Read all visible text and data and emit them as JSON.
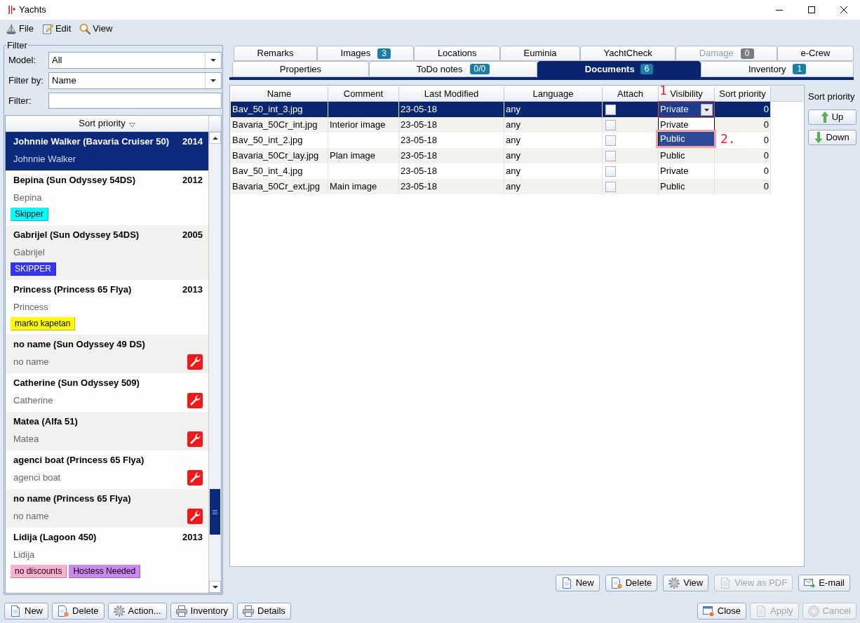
{
  "window": {
    "title": "Yachts"
  },
  "menu": [
    {
      "label": "File",
      "kind": "file"
    },
    {
      "label": "Edit",
      "kind": "edit"
    },
    {
      "label": "View",
      "kind": "view"
    }
  ],
  "filter": {
    "legend": "Filter",
    "fields": [
      {
        "label": "Model:",
        "kind": "combo",
        "value": "All"
      },
      {
        "label": "Filter by:",
        "kind": "combo",
        "value": "Name"
      },
      {
        "label": "Filter:",
        "kind": "text"
      }
    ]
  },
  "yacht_list": {
    "header": "Sort priority",
    "items": [
      {
        "title": "Johnnie Walker (Bavaria Cruiser 50)",
        "year": "2014",
        "subtitle": "Johnnie Walker",
        "selected": true,
        "service": false
      },
      {
        "title": "Bepina (Sun Odyssey 54DS)",
        "year": "2012",
        "subtitle": "Bepina",
        "selected": false,
        "service": false,
        "tags": [
          {
            "label": "Skipper",
            "color": "#00ffff"
          }
        ]
      },
      {
        "title": "Gabrijel (Sun Odyssey 54DS)",
        "year": "2005",
        "subtitle": "Gabrijel",
        "selected": false,
        "service": false,
        "tags": [
          {
            "label": "SKIPPER",
            "color": "#3333ff"
          }
        ]
      },
      {
        "title": "Princess (Princess 65 Flya)",
        "year": "2013",
        "subtitle": "Princess",
        "selected": false,
        "service": false,
        "tags": [
          {
            "label": "marko kapetan",
            "color": "#ffff00"
          }
        ]
      },
      {
        "title": "no name (Sun Odyssey 49 DS)",
        "subtitle": "no name",
        "selected": false,
        "service": true
      },
      {
        "title": "Catherine (Sun Odyssey 509)",
        "subtitle": "Catherine",
        "selected": false,
        "service": true
      },
      {
        "title": "Matea (Alfa 51)",
        "subtitle": "Matea",
        "selected": false,
        "service": true
      },
      {
        "title": "agenci boat (Princess 65 Flya)",
        "subtitle": "agenci boat",
        "selected": false,
        "service": true
      },
      {
        "title": "no name (Princess 65 Flya)",
        "subtitle": "no name",
        "selected": false,
        "service": true
      },
      {
        "title": "Lidija (Lagoon 450)",
        "year": "2013",
        "subtitle": "Lidija",
        "selected": false,
        "service": false,
        "tags": [
          {
            "label": "no discounts",
            "color": "#ffb0d0"
          },
          {
            "label": "Hostess Needed",
            "color": "#cc88f0"
          }
        ]
      }
    ]
  },
  "tab_strip": {
    "rows": [
      {
        "tabs": [
          {
            "label": "Remarks",
            "selected": false,
            "disabled": false
          },
          {
            "label": "Images",
            "badge": "3",
            "selected": false,
            "disabled": false
          },
          {
            "label": "Locations",
            "selected": false,
            "disabled": false
          },
          {
            "label": "Euminia",
            "selected": false,
            "disabled": false
          },
          {
            "label": "YachtCheck",
            "selected": false,
            "disabled": false
          },
          {
            "label": "Damage",
            "badge": "0",
            "selected": false,
            "disabled": true
          },
          {
            "label": "e-Crew",
            "selected": false,
            "disabled": false
          }
        ]
      },
      {
        "tabs": [
          {
            "label": "Properties",
            "selected": false,
            "disabled": false
          },
          {
            "label": "ToDo notes",
            "badge": "0/0",
            "selected": false,
            "disabled": false
          },
          {
            "label": "Documents",
            "badge": "6",
            "selected": true,
            "disabled": false
          },
          {
            "label": "Inventory",
            "badge": "1",
            "selected": false,
            "disabled": false
          }
        ]
      }
    ]
  },
  "documents_table": {
    "columns": [
      "Name",
      "Comment",
      "Last Modified",
      "Language",
      "Attach",
      "Visibility",
      "Sort priority"
    ],
    "rows": [
      {
        "name": "Bav_50_int_3.jpg",
        "last_modified": "23-05-18",
        "language": "any",
        "attach": false,
        "visibility": "Private",
        "sort_priority": "0",
        "selected": true
      },
      {
        "name": "Bavaria_50Cr_int.jpg",
        "comment": "Interior image",
        "last_modified": "23-05-18",
        "language": "any",
        "attach": false,
        "sort_priority": "0",
        "selected": false
      },
      {
        "name": "Bav_50_int_2.jpg",
        "last_modified": "23-05-18",
        "language": "any",
        "attach": false,
        "sort_priority": "0",
        "selected": false
      },
      {
        "name": "Bavaria_50Cr_lay.jpg",
        "comment": "Plan image",
        "last_modified": "23-05-18",
        "language": "any",
        "attach": false,
        "visibility": "Public",
        "sort_priority": "0",
        "selected": false
      },
      {
        "name": "Bav_50_int_4.jpg",
        "last_modified": "23-05-18",
        "language": "any",
        "attach": false,
        "visibility": "Private",
        "sort_priority": "0",
        "selected": false
      },
      {
        "name": "Bavaria_50Cr_ext.jpg",
        "comment": "Main image",
        "last_modified": "23-05-18",
        "language": "any",
        "attach": false,
        "visibility": "Public",
        "sort_priority": "0",
        "selected": false
      }
    ],
    "visibility_popup": {
      "options": [
        {
          "label": "Private",
          "selected": false
        },
        {
          "label": "Public",
          "selected": true
        }
      ]
    },
    "annotations": [
      {
        "label": "1"
      },
      {
        "label": "2."
      }
    ]
  },
  "sort_panel": {
    "label": "Sort priority",
    "buttons": [
      {
        "label": "Up",
        "kind": "up"
      },
      {
        "label": "Down",
        "kind": "down"
      }
    ]
  },
  "document_buttons": [
    {
      "label": "New",
      "kind": "new",
      "disabled": false
    },
    {
      "label": "Delete",
      "kind": "delete",
      "disabled": false
    },
    {
      "label": "View",
      "kind": "view",
      "disabled": false
    },
    {
      "label": "View as PDF",
      "kind": "pdf",
      "disabled": true
    },
    {
      "label": "E-mail",
      "kind": "email",
      "disabled": false
    }
  ],
  "footer_buttons": {
    "left": [
      {
        "label": "New",
        "kind": "new",
        "disabled": false
      },
      {
        "label": "Delete",
        "kind": "delete",
        "disabled": false
      },
      {
        "label": "Action...",
        "kind": "action",
        "disabled": false
      },
      {
        "label": "Inventory",
        "kind": "print",
        "disabled": false
      },
      {
        "label": "Details",
        "kind": "print",
        "disabled": false
      }
    ],
    "right": [
      {
        "label": "Close",
        "kind": "close",
        "disabled": false
      },
      {
        "label": "Apply",
        "kind": "apply",
        "disabled": true
      },
      {
        "label": "Cancel",
        "kind": "cancel",
        "disabled": true
      }
    ]
  }
}
